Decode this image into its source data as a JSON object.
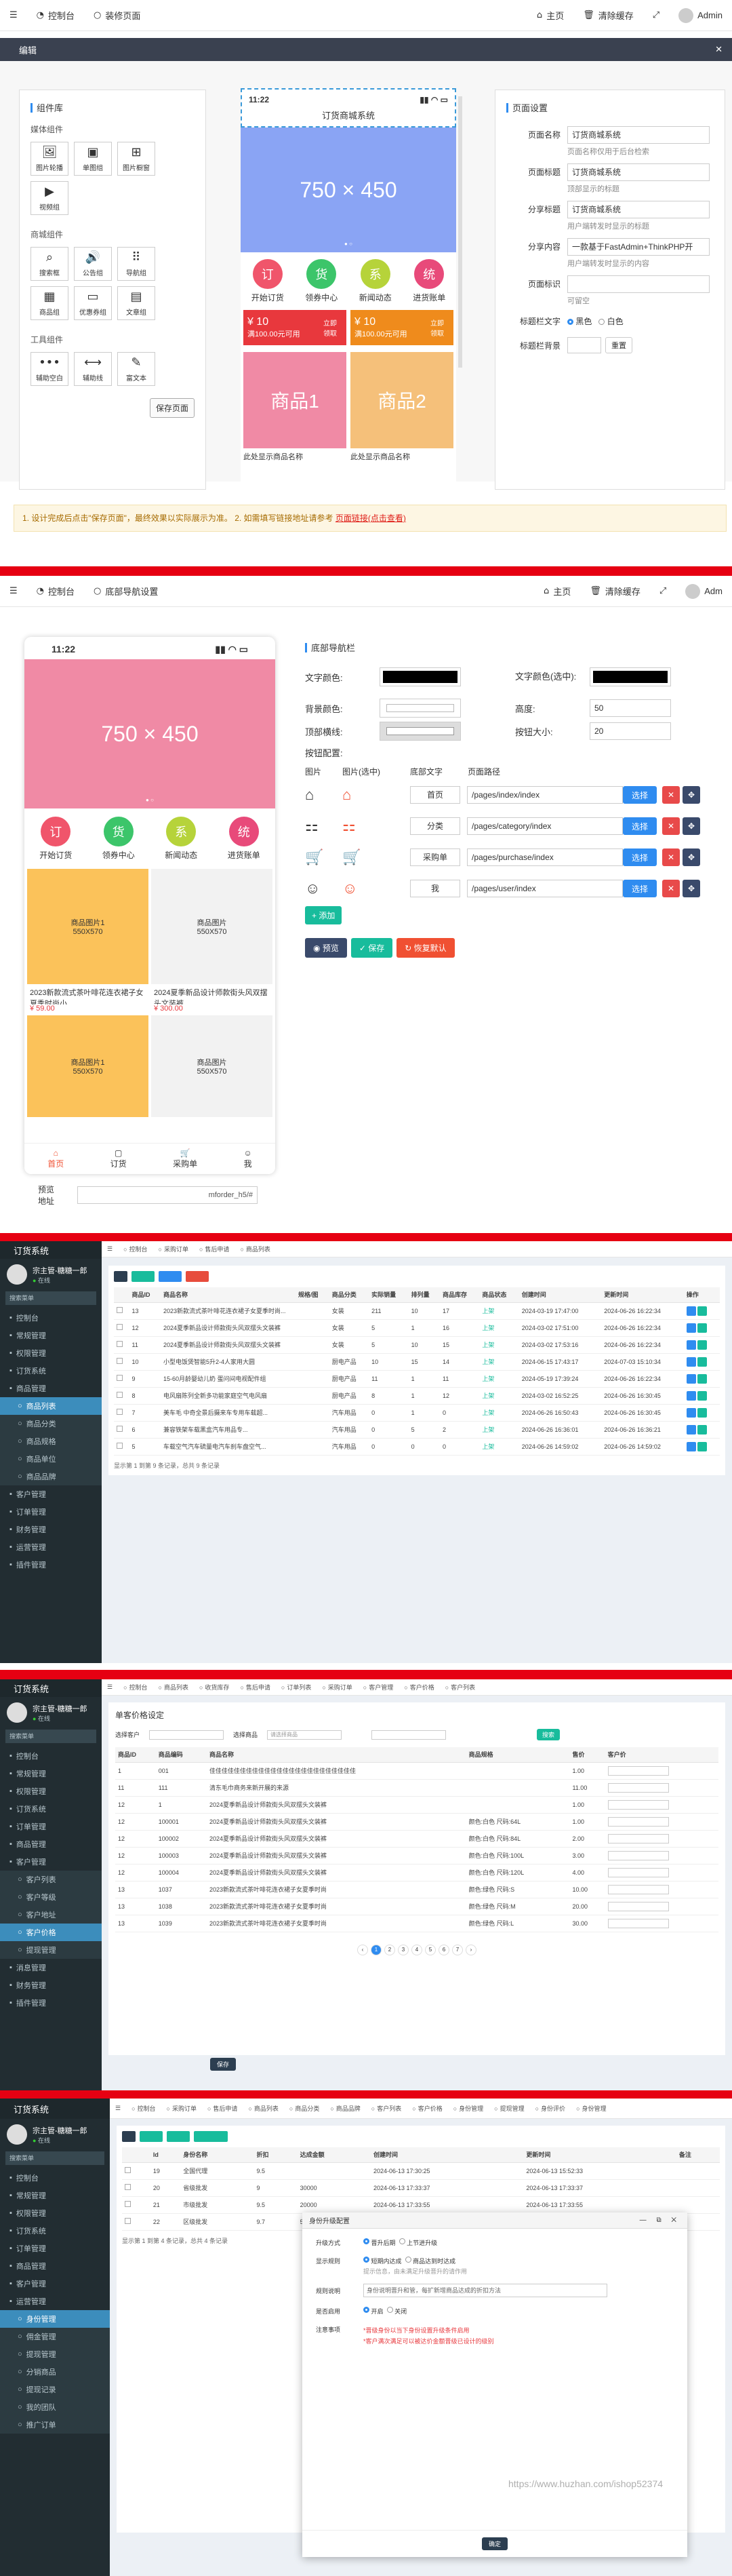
{
  "s1": {
    "top": {
      "dashboard": "控制台",
      "page": "装修页面",
      "home": "主页",
      "clear_cache": "清除缓存",
      "user": "Admin"
    },
    "editor_title": "编辑",
    "comp_lib": "组件库",
    "groups": [
      {
        "title": "媒体组件",
        "items": [
          "图片轮播",
          "单图组",
          "图片橱窗",
          "视频组"
        ]
      },
      {
        "title": "商城组件",
        "items": [
          "搜索框",
          "公告组",
          "导航组",
          "商品组",
          "优惠券组",
          "文章组"
        ]
      },
      {
        "title": "工具组件",
        "items": [
          "辅助空白",
          "辅助线",
          "富文本"
        ]
      }
    ],
    "save_page": "保存页面",
    "phone": {
      "time": "11:22",
      "title": "订货商城系统",
      "banner": "750 × 450",
      "nav": [
        {
          "char": "订",
          "label": "开始订货",
          "color": "#f0556b"
        },
        {
          "char": "货",
          "label": "领券中心",
          "color": "#3cc56a"
        },
        {
          "char": "系",
          "label": "新闻动态",
          "color": "#b6d33a"
        },
        {
          "char": "统",
          "label": "进货账单",
          "color": "#e84a7a"
        }
      ],
      "coupons": [
        {
          "amount": "¥ 10",
          "cond": "满100.00元可用",
          "btn": "立即领取",
          "color": "#e8383d"
        },
        {
          "amount": "¥ 10",
          "cond": "满100.00元可用",
          "btn": "立即领取",
          "color": "#ef8b1c"
        }
      ],
      "products": [
        {
          "label": "商品1",
          "name": "此处显示商品名称",
          "color": "#f08aa5"
        },
        {
          "label": "商品2",
          "name": "此处显示商品名称",
          "color": "#f5c07a"
        }
      ]
    },
    "settings_title": "页面设置",
    "fields": [
      {
        "label": "页面名称",
        "value": "订货商城系统",
        "hint": "页面名称仅用于后台检索"
      },
      {
        "label": "页面标题",
        "value": "订货商城系统",
        "hint": "顶部显示的标题"
      },
      {
        "label": "分享标题",
        "value": "订货商城系统",
        "hint": "用户端转发时显示的标题"
      },
      {
        "label": "分享内容",
        "value": "一款基于FastAdmin+ThinkPHP开",
        "hint": "用户端转发时显示的内容"
      },
      {
        "label": "页面标识",
        "value": "",
        "hint": "可留空"
      }
    ],
    "title_text_label": "标题栏文字",
    "title_text_opts": [
      "黑色",
      "白色"
    ],
    "title_bg_label": "标题栏背景",
    "title_bg_btn": "重置",
    "notice": "1. 设计完成后点击\"保存页面\"，最终效果以实际展示为准。  2. 如需填写链接地址请参考",
    "notice_link": "页面链接(点击查看)"
  },
  "s2": {
    "top": {
      "dashboard": "控制台",
      "page": "底部导航设置",
      "home": "主页",
      "clear_cache": "清除缓存",
      "user": "Adm"
    },
    "phone": {
      "time": "11:22",
      "banner": "750 × 450",
      "nav": [
        {
          "char": "订",
          "label": "开始订货",
          "color": "#f0556b"
        },
        {
          "char": "货",
          "label": "领券中心",
          "color": "#3cc56a"
        },
        {
          "char": "系",
          "label": "新闻动态",
          "color": "#b6d33a"
        },
        {
          "char": "统",
          "label": "进货账单",
          "color": "#e84a7a"
        }
      ],
      "products": [
        {
          "img": "商品图片1\n550X570",
          "name": "2023新款流式茶叶啡花连衣裙子女夏季时尚小...",
          "price": "¥ 59.00",
          "bg": "#fbc25a"
        },
        {
          "img": "商品图片\n550X570",
          "name": "2024夏季新品设计师款街头风双摆头文装裤",
          "price": "¥ 300.00",
          "bg": "#f2f2f2"
        },
        {
          "img": "商品图片1\n550X570",
          "name": "",
          "price": "",
          "bg": "#fbc25a"
        },
        {
          "img": "商品图片\n550X570",
          "name": "",
          "price": "",
          "bg": "#f2f2f2"
        }
      ],
      "tabs": [
        "首页",
        "订货",
        "采购单",
        "我"
      ]
    },
    "preview_label": "预览\n地址",
    "preview_url": "mforder_h5/#",
    "panel_title": "底部导航栏",
    "text_color": "文字颜色:",
    "text_color_sel": "文字颜色(选中):",
    "bg_color": "背景颜色:",
    "height_label": "高度:",
    "height_val": "50",
    "top_line": "顶部横线:",
    "size_label": "按钮大小:",
    "size_val": "20",
    "btn_config": "按钮配置:",
    "headers": [
      "图片",
      "图片(选中)",
      "底部文字",
      "页面路径"
    ],
    "rows": [
      {
        "text": "首页",
        "path": "/pages/index/index",
        "icon": "⌂"
      },
      {
        "text": "分类",
        "path": "/pages/category/index",
        "icon": "⚏"
      },
      {
        "text": "采购单",
        "path": "/pages/purchase/index",
        "icon": "🛒"
      },
      {
        "text": "我",
        "path": "/pages/user/index",
        "icon": "☺"
      }
    ],
    "choose": "选择",
    "add": "+ 添加",
    "preview": "预览",
    "save": "保存",
    "restore": "恢复默认"
  },
  "s3": {
    "brand": "订货系统",
    "user": "宗主管-糖糖一郎",
    "online": "在线",
    "search": "搜索菜单",
    "menu": [
      "控制台",
      "常规管理",
      "权限管理",
      "订货系统",
      "商品管理",
      "商品列表",
      "商品分类",
      "商品规格",
      "商品单位",
      "商品品牌",
      "客户管理",
      "订单管理",
      "财务管理",
      "运营管理",
      "插件管理"
    ],
    "tabs": [
      "控制台",
      "采购订单",
      "售后申请",
      "商品列表"
    ],
    "headers": [
      "",
      "商品ID",
      "商品名称",
      "规格/图",
      "商品分类",
      "实际销量",
      "排列量",
      "商品库存",
      "商品状态",
      "创建时间",
      "更新时间",
      "操作"
    ],
    "rows": [
      [
        "13",
        "2023新款流式茶叶啡花连衣裙子女夏季时尚...",
        "",
        "女装",
        "211",
        "10",
        "17",
        "上架",
        "2024-03-19 17:47:00",
        "2024-06-26 16:22:34"
      ],
      [
        "12",
        "2024夏季新品设计师款街头风双摆头文装裤",
        "",
        "女装",
        "5",
        "1",
        "16",
        "上架",
        "2024-03-02 17:51:00",
        "2024-06-26 16:22:34"
      ],
      [
        "11",
        "2024夏季新品设计师款街头风双摆头文装裤",
        "",
        "女装",
        "5",
        "10",
        "15",
        "上架",
        "2024-03-02 17:53:16",
        "2024-06-26 16:22:34"
      ],
      [
        "10",
        "小型电饭煲智能5升2-4人家用大圆",
        "",
        "厨电产品",
        "10",
        "15",
        "14",
        "上架",
        "2024-06-15 17:43:17",
        "2024-07-03 15:10:34"
      ],
      [
        "9",
        "15-60月龄婴幼儿奶 蛋问间电视配件组",
        "",
        "厨电产品",
        "11",
        "1",
        "11",
        "上架",
        "2024-05-19 17:39:24",
        "2024-06-26 16:22:34"
      ],
      [
        "8",
        "电风扇陈列全新多功能家庭空气电风扇",
        "",
        "厨电产品",
        "8",
        "1",
        "12",
        "上架",
        "2024-03-02 16:52:25",
        "2024-06-26 16:30:45"
      ],
      [
        "7",
        "美车毛 中奇全景后摄来车专用车载超...",
        "",
        "汽车用品",
        "0",
        "1",
        "0",
        "上架",
        "2024-06-26 16:50:43",
        "2024-06-26 16:30:45"
      ],
      [
        "6",
        "兼容铁架车载黑盒汽车用品专...",
        "",
        "汽车用品",
        "0",
        "5",
        "2",
        "上架",
        "2024-06-26 16:36:01",
        "2024-06-26 16:36:21"
      ],
      [
        "5",
        "车载空气汽车硫量电汽车刹车盘空气...",
        "",
        "汽车用品",
        "0",
        "0",
        "0",
        "上架",
        "2024-06-26 14:59:02",
        "2024-06-26 14:59:02"
      ]
    ],
    "footer": "显示第 1 到第 9 条记录，总共 9 条记录"
  },
  "s4": {
    "brand": "订货系统",
    "user": "宗主管-糖糖一郎",
    "online": "在线",
    "search": "搜索菜单",
    "menu": [
      "控制台",
      "常规管理",
      "权限管理",
      "订货系统",
      "订单管理",
      "商品管理",
      "客户管理",
      "客户列表",
      "客户等级",
      "客户地址",
      "客户价格",
      "提现管理",
      "消息管理",
      "财务管理",
      "插件管理"
    ],
    "tabs": [
      "控制台",
      "商品列表",
      "收货库存",
      "售后申请",
      "订单列表",
      "采购订单",
      "客户管理",
      "客户价格",
      "客户列表"
    ],
    "title": "单客价格设定",
    "filters": [
      "选择客户",
      "选择商品",
      "请选择商品"
    ],
    "search_btn": "搜索",
    "headers": [
      "商品ID",
      "商品编码",
      "商品名称",
      "商品规格",
      "售价",
      "客户价"
    ],
    "rows": [
      [
        "1",
        "001",
        "佳佳佳佳佳佳佳佳佳佳佳佳佳佳佳佳佳佳佳佳佳佳佳佳",
        "",
        "1.00"
      ],
      [
        "11",
        "111",
        "清东毛巾商务来新开展的来源",
        "",
        "11.00"
      ],
      [
        "12",
        "1",
        "2024夏季新品设计师款街头风双摆头文装裤",
        "",
        "1.00"
      ],
      [
        "12",
        "100001",
        "2024夏季新品设计师款街头风双摆头文装裤",
        "颜色:白色 尺码:64L",
        "1.00"
      ],
      [
        "12",
        "100002",
        "2024夏季新品设计师款街头风双摆头文装裤",
        "颜色:白色 尺码:84L",
        "2.00"
      ],
      [
        "12",
        "100003",
        "2024夏季新品设计师款街头风双摆头文装裤",
        "颜色:白色 尺码:100L",
        "3.00"
      ],
      [
        "12",
        "100004",
        "2024夏季新品设计师款街头风双摆头文装裤",
        "颜色:白色 尺码:120L",
        "4.00"
      ],
      [
        "13",
        "1037",
        "2023新款流式茶叶啡花连衣裙子女夏季时尚",
        "颜色:绿色 尺码:S",
        "10.00"
      ],
      [
        "13",
        "1038",
        "2023新款流式茶叶啡花连衣裙子女夏季时尚",
        "颜色:绿色 尺码:M",
        "20.00"
      ],
      [
        "13",
        "1039",
        "2023新款流式茶叶啡花连衣裙子女夏季时尚",
        "颜色:绿色 尺码:L",
        "30.00"
      ]
    ],
    "pages": [
      "‹",
      "1",
      "2",
      "3",
      "4",
      "5",
      "6",
      "7",
      "›"
    ],
    "save_btn": "保存"
  },
  "s5": {
    "brand": "订货系统",
    "user": "宗主管-糖糖一郎",
    "online": "在线",
    "search": "搜索菜单",
    "menu": [
      "控制台",
      "常规管理",
      "权限管理",
      "订货系统",
      "订单管理",
      "商品管理",
      "客户管理",
      "运营管理",
      "身份管理",
      "佣金管理",
      "提现管理",
      "分销商品",
      "提现记录",
      "我的团队",
      "推广订单"
    ],
    "tabs": [
      "控制台",
      "采购订单",
      "售后申请",
      "商品列表",
      "商品分类",
      "商品品牌",
      "客户列表",
      "客户价格",
      "身份管理",
      "提现管理",
      "身份评价",
      "身份管理"
    ],
    "headers": [
      "",
      "Id",
      "身份名称",
      "折扣",
      "达成金额",
      "创建时间",
      "更新时间",
      "备注"
    ],
    "rows": [
      [
        "19",
        "全国代理",
        "9.5",
        "",
        "2024-06-13 17:30:25",
        "2024-06-13 15:52:33"
      ],
      [
        "20",
        "省级批发",
        "9",
        "30000",
        "2024-06-13 17:33:37",
        "2024-06-13 17:33:37"
      ],
      [
        "21",
        "市级批发",
        "9.5",
        "20000",
        "2024-06-13 17:33:55",
        "2024-06-13 17:33:55"
      ],
      [
        "22",
        "区级批发",
        "9.7",
        "5000",
        "2024-06-13 17:34:33",
        "2024-06-13 17:34:33"
      ]
    ],
    "footer": "显示第 1 到第 4 条记录，总共 4 条记录",
    "modal": {
      "title": "身份升级配置",
      "up_label": "升级方式",
      "up_opts": [
        "晋升后期",
        "上节进升级"
      ],
      "dist_label": "显示规则",
      "dist_opts": [
        "短期内达成",
        "商品达到时达成"
      ],
      "hint1": "提示信息，由未满足升级晋升的请作用",
      "desc_label": "规则说明",
      "desc_val": "身份说明晋升和管，每扩新增商品达成的折扣方法",
      "open_label": "是否启用",
      "open_opts": [
        "开启",
        "关闭"
      ],
      "note_label": "注意事项",
      "note1": "*晋级身份以当下身份设置升级条件启用",
      "note2": "*客户满次满足可以被达价金额晋级已设计的级别",
      "submit": "确定"
    },
    "watermark": "https://www.huzhan.com/ishop52374"
  }
}
